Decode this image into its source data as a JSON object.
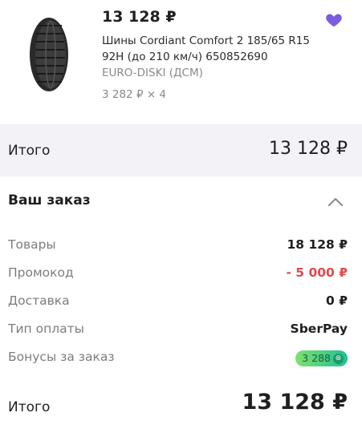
{
  "product": {
    "price": "13 128 ₽",
    "name": "Шины Cordiant Comfort 2 185/65 R15 92H (до 210 км/ч) 650852690",
    "seller": "EURO-DISKI (ДСМ)",
    "unit_qty": "3 282 ₽ × 4",
    "image_icon": "tire-image",
    "favorite_icon": "heart-icon",
    "favorite_color": "#7b5ce0"
  },
  "total_bar": {
    "label": "Итого",
    "value": "13 128 ₽"
  },
  "order": {
    "title": "Ваш заказ",
    "toggle_icon": "chevron-up-icon",
    "rows": [
      {
        "label": "Товары",
        "value": "18 128 ₽"
      },
      {
        "label": "Промокод",
        "value": "- 5 000 ₽"
      },
      {
        "label": "Доставка",
        "value": "0 ₽"
      },
      {
        "label": "Тип оплаты",
        "value": "SberPay"
      },
      {
        "label": "Бонусы за заказ",
        "value": "3 288"
      }
    ],
    "bonus_icon": "sber-bonus-icon"
  },
  "final": {
    "label": "Итого",
    "value": "13 128 ₽"
  },
  "colors": {
    "accent_red": "#e5484d",
    "bonus_green": "#21c190",
    "total_bg": "#f2f2f7"
  }
}
